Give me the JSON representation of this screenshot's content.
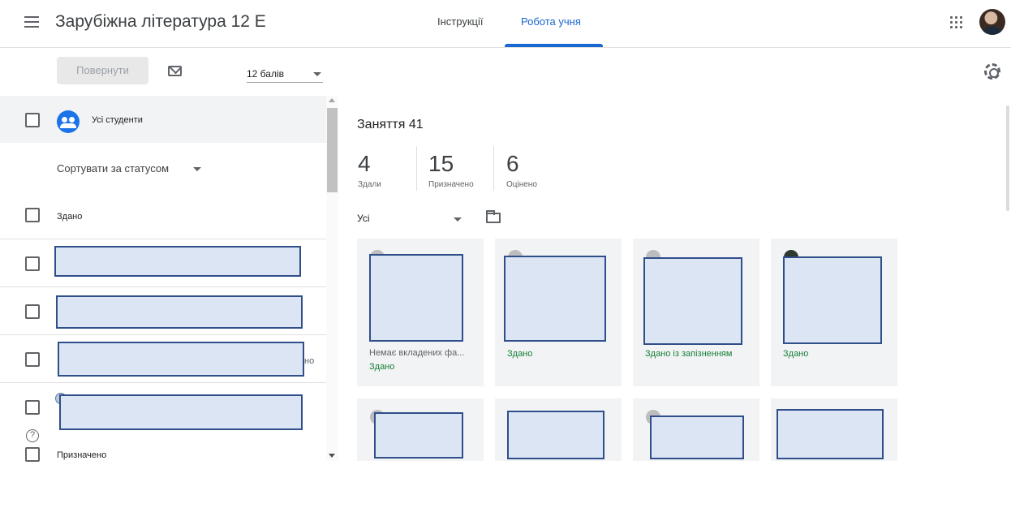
{
  "header": {
    "course_title": "Зарубіжна література 12 Е",
    "tabs": [
      {
        "label": "Інструкції",
        "active": false
      },
      {
        "label": "Робота учня",
        "active": true
      }
    ],
    "accent_color": "#1967d2"
  },
  "toolbar": {
    "return_label": "Повернути",
    "points_value": "12 балів"
  },
  "student_list": {
    "all_students_label": "Усі студенти",
    "sort_label": "Сортувати за статусом",
    "sections": [
      {
        "label": "Здано"
      },
      {
        "label": "Призначено"
      }
    ],
    "row_fragment": "но"
  },
  "assignment": {
    "title": "Заняття 41",
    "stats": [
      {
        "value": "4",
        "label": "Здали"
      },
      {
        "value": "15",
        "label": "Призначено"
      },
      {
        "value": "6",
        "label": "Оцінено"
      }
    ],
    "filter_value": "Усі",
    "cards": [
      {
        "note": "Немає вкладених фа...",
        "status": "Здано"
      },
      {
        "note": "",
        "status": "Здано"
      },
      {
        "note": "",
        "status": "Здано із запізненням"
      },
      {
        "note": "",
        "status": "Здано"
      }
    ],
    "status_color": "#188038"
  },
  "icons": [
    "menu-icon",
    "apps-icon",
    "avatar",
    "email-icon",
    "settings-icon",
    "group-icon",
    "folder-icon",
    "help-icon"
  ]
}
